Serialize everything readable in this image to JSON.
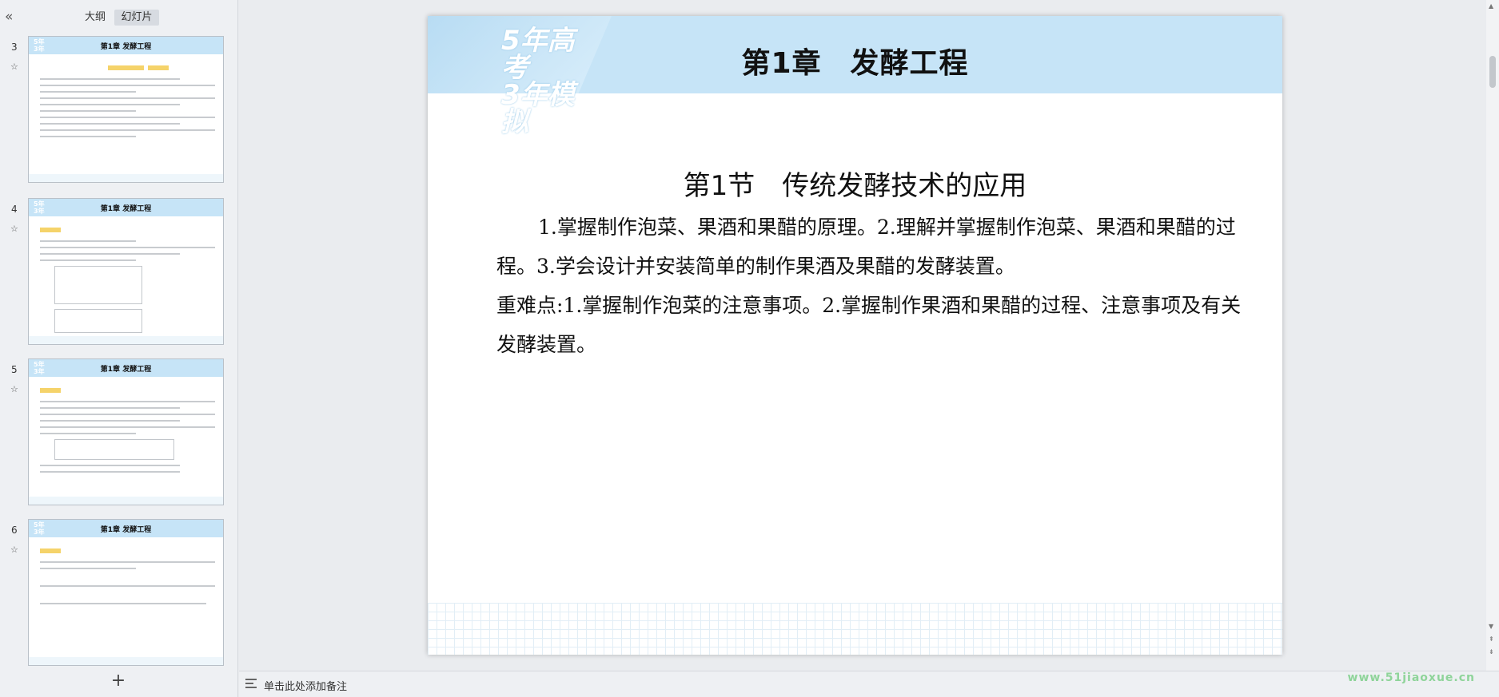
{
  "sidebar": {
    "tabs": {
      "outline": "大纲",
      "slides": "幻灯片"
    },
    "thumbnails": [
      {
        "number": "3",
        "title": "第1章   发酵工程"
      },
      {
        "number": "4",
        "title": "第1章   发酵工程"
      },
      {
        "number": "5",
        "title": "第1章   发酵工程"
      },
      {
        "number": "6",
        "title": "第1章   发酵工程"
      }
    ],
    "add_slide": "+"
  },
  "slide": {
    "logo_line1": "5年高考",
    "logo_line2": "3年模拟",
    "chapter": {
      "part1": "第1章",
      "part2": "发酵工程"
    },
    "section": "第1节　传统发酵技术的应用",
    "paragraph1": "1.掌握制作泡菜、果酒和果醋的原理。2.理解并掌握制作泡菜、果酒和果醋的过程。3.学会设计并安装简单的制作果酒及果醋的发酵装置。",
    "paragraph2": "重难点:1.掌握制作泡菜的注意事项。2.掌握制作果酒和果醋的过程、注意事项及有关发酵装置。"
  },
  "notes": {
    "placeholder": "单击此处添加备注"
  },
  "watermark": "www.51jiaoxue.cn"
}
